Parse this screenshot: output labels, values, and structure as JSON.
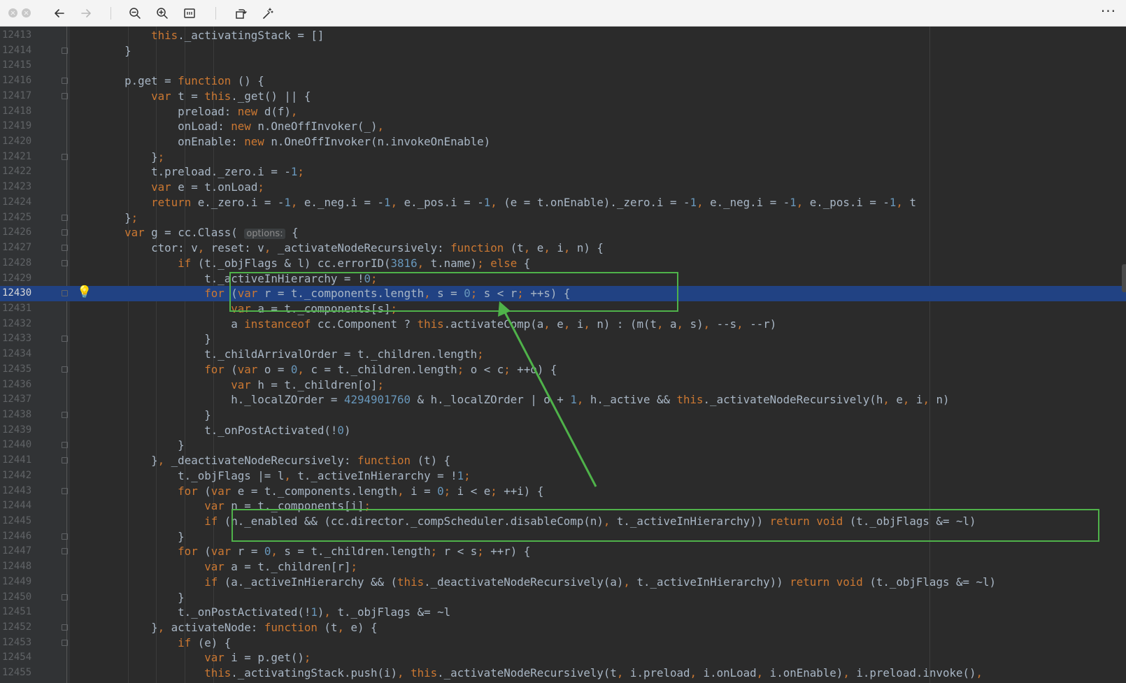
{
  "toolbar": {
    "close_icon": "close-icon",
    "minimize_icon": "minimize-icon",
    "back_icon": "arrow-left-icon",
    "forward_icon": "arrow-right-icon",
    "zoom_out_icon": "zoom-out-icon",
    "zoom_in_icon": "zoom-in-icon",
    "fit_icon": "fit-page-icon",
    "rotate_icon": "rotate-icon",
    "markup_icon": "magic-wand-icon",
    "more_label": "···"
  },
  "editor": {
    "first_line": 12413,
    "current_line": 12430,
    "lightbulb_icon": "lightbulb-icon",
    "colors": {
      "keyword": "#cc7832",
      "number": "#6897bb",
      "text": "#a9b7c6",
      "function": "#ffc66d",
      "current_line": "#214283",
      "annotation": "#4fb24a"
    },
    "lines": [
      {
        "no": "12413",
        "fold": false,
        "html": "            <span class='k'>this</span>._activatingStack = []"
      },
      {
        "no": "12414",
        "fold": true,
        "html": "        }"
      },
      {
        "no": "12415",
        "fold": false,
        "html": ""
      },
      {
        "no": "12416",
        "fold": true,
        "html": "        p.get = <span class='k'>function</span> () {"
      },
      {
        "no": "12417",
        "fold": true,
        "html": "            <span class='k'>var</span> t = <span class='k'>this</span>._get() || {"
      },
      {
        "no": "12418",
        "fold": false,
        "html": "                preload: <span class='k'>new</span> d(f)<span class='k'>,</span>"
      },
      {
        "no": "12419",
        "fold": false,
        "html": "                onLoad: <span class='k'>new</span> n.OneOffInvoker(_)<span class='k'>,</span>"
      },
      {
        "no": "12420",
        "fold": false,
        "html": "                onEnable: <span class='k'>new</span> n.OneOffInvoker(n.invokeOnEnable)"
      },
      {
        "no": "12421",
        "fold": true,
        "html": "            }<span class='k'>;</span>"
      },
      {
        "no": "12422",
        "fold": false,
        "html": "            t.preload._zero.i = -<span class='n'>1</span><span class='k'>;</span>"
      },
      {
        "no": "12423",
        "fold": false,
        "html": "            <span class='k'>var</span> e = t.onLoad<span class='k'>;</span>"
      },
      {
        "no": "12424",
        "fold": false,
        "html": "            <span class='k'>return</span> e._zero.i = -<span class='n'>1</span><span class='k'>,</span> e._neg.i = -<span class='n'>1</span><span class='k'>,</span> e._pos.i = -<span class='n'>1</span><span class='k'>,</span> (e = t.onEnable)._zero.i = -<span class='n'>1</span><span class='k'>,</span> e._neg.i = -<span class='n'>1</span><span class='k'>,</span> e._pos.i = -<span class='n'>1</span><span class='k'>,</span> t"
      },
      {
        "no": "12425",
        "fold": true,
        "html": "        }<span class='k'>;</span>"
      },
      {
        "no": "12426",
        "fold": true,
        "html": "        <span class='k'>var</span> g = cc.Class( <span class='hint'>options:</span> {"
      },
      {
        "no": "12427",
        "fold": true,
        "html": "            ctor: v<span class='k'>,</span> reset: v<span class='k'>,</span> _activateNodeRecursively: <span class='k'>function</span> (t<span class='k'>,</span> e<span class='k'>,</span> i<span class='k'>,</span> n) {"
      },
      {
        "no": "12428",
        "fold": true,
        "html": "                <span class='k'>if</span> (t._objFlags &amp; l) cc.errorID(<span class='n'>3816</span><span class='k'>,</span> t.name)<span class='k'>; else</span> {"
      },
      {
        "no": "12429",
        "fold": false,
        "html": "                    t._activeInHierarchy = !<span class='n'>0</span><span class='k'>;</span>"
      },
      {
        "no": "12430",
        "fold": true,
        "html": "                    <span class='k'>for</span> (<span class='k'>var</span> r = t._components.length<span class='k'>,</span> s = <span class='n'>0</span><span class='k'>;</span> s &lt; r<span class='k'>;</span> ++s) {"
      },
      {
        "no": "12431",
        "fold": false,
        "html": "                        <span class='k'>var</span> a = t._components[s]<span class='k'>;</span>"
      },
      {
        "no": "12432",
        "fold": false,
        "html": "                        a <span class='k'>instanceof</span> cc.Component ? <span class='k'>this</span>.activateComp(a<span class='k'>,</span> e<span class='k'>,</span> i<span class='k'>,</span> n) : (m(t<span class='k'>,</span> a<span class='k'>,</span> s)<span class='k'>,</span> --s<span class='k'>,</span> --r)"
      },
      {
        "no": "12433",
        "fold": true,
        "html": "                    }"
      },
      {
        "no": "12434",
        "fold": false,
        "html": "                    t._childArrivalOrder = t._children.length<span class='k'>;</span>"
      },
      {
        "no": "12435",
        "fold": true,
        "html": "                    <span class='k'>for</span> (<span class='k'>var</span> o = <span class='n'>0</span><span class='k'>,</span> c = t._children.length<span class='k'>;</span> o &lt; c<span class='k'>;</span> ++o) {"
      },
      {
        "no": "12436",
        "fold": false,
        "html": "                        <span class='k'>var</span> h = t._children[o]<span class='k'>;</span>"
      },
      {
        "no": "12437",
        "fold": false,
        "html": "                        h._localZOrder = <span class='n'>4294901760</span> &amp; h._localZOrder | o + <span class='n'>1</span><span class='k'>,</span> h._active &amp;&amp; <span class='k'>this</span>._activateNodeRecursively(h<span class='k'>,</span> e<span class='k'>,</span> i<span class='k'>,</span> n)"
      },
      {
        "no": "12438",
        "fold": true,
        "html": "                    }"
      },
      {
        "no": "12439",
        "fold": false,
        "html": "                    t._onPostActivated(!<span class='n'>0</span>)"
      },
      {
        "no": "12440",
        "fold": true,
        "html": "                }"
      },
      {
        "no": "12441",
        "fold": true,
        "html": "            }<span class='k'>,</span> _deactivateNodeRecursively: <span class='k'>function</span> (t) {"
      },
      {
        "no": "12442",
        "fold": false,
        "html": "                t._objFlags |= l<span class='k'>,</span> t._activeInHierarchy = !<span class='n'>1</span><span class='k'>;</span>"
      },
      {
        "no": "12443",
        "fold": true,
        "html": "                <span class='k'>for</span> (<span class='k'>var</span> e = t._components.length<span class='k'>,</span> i = <span class='n'>0</span><span class='k'>;</span> i &lt; e<span class='k'>;</span> ++i) {"
      },
      {
        "no": "12444",
        "fold": false,
        "html": "                    <span class='k'>var</span> n = t._components[i]<span class='k'>;</span>"
      },
      {
        "no": "12445",
        "fold": false,
        "html": "                    <span class='k'>if</span> (n._enabled &amp;&amp; (cc.director._compScheduler.disableComp(n)<span class='k'>,</span> t._activeInHierarchy)) <span class='k'>return void</span> (t._objFlags &amp;= ~l)"
      },
      {
        "no": "12446",
        "fold": true,
        "html": "                }"
      },
      {
        "no": "12447",
        "fold": true,
        "html": "                <span class='k'>for</span> (<span class='k'>var</span> r = <span class='n'>0</span><span class='k'>,</span> s = t._children.length<span class='k'>;</span> r &lt; s<span class='k'>;</span> ++r) {"
      },
      {
        "no": "12448",
        "fold": false,
        "html": "                    <span class='k'>var</span> a = t._children[r]<span class='k'>;</span>"
      },
      {
        "no": "12449",
        "fold": false,
        "html": "                    <span class='k'>if</span> (a._activeInHierarchy &amp;&amp; (<span class='k'>this</span>._deactivateNodeRecursively(a)<span class='k'>,</span> t._activeInHierarchy)) <span class='k'>return void</span> (t._objFlags &amp;= ~l)"
      },
      {
        "no": "12450",
        "fold": true,
        "html": "                }"
      },
      {
        "no": "12451",
        "fold": false,
        "html": "                t._onPostActivated(!<span class='n'>1</span>)<span class='k'>,</span> t._objFlags &amp;= ~l"
      },
      {
        "no": "12452",
        "fold": true,
        "html": "            }<span class='k'>,</span> activateNode: <span class='k'>function</span> (t<span class='k'>,</span> e) {"
      },
      {
        "no": "12453",
        "fold": true,
        "html": "                <span class='k'>if</span> (e) {"
      },
      {
        "no": "12454",
        "fold": false,
        "html": "                    <span class='k'>var</span> i = p.get()<span class='k'>;</span>"
      },
      {
        "no": "12455",
        "fold": false,
        "html": "                    <span class='k'>this</span>._activatingStack.push(i)<span class='k'>,</span> <span class='k'>this</span>._activateNodeRecursively(t<span class='k'>,</span> i.preload<span class='k'>,</span> i.onLoad<span class='k'>,</span> i.onEnable)<span class='k'>,</span> i.preload.invoke()<span class='k'>,</span>"
      }
    ]
  }
}
